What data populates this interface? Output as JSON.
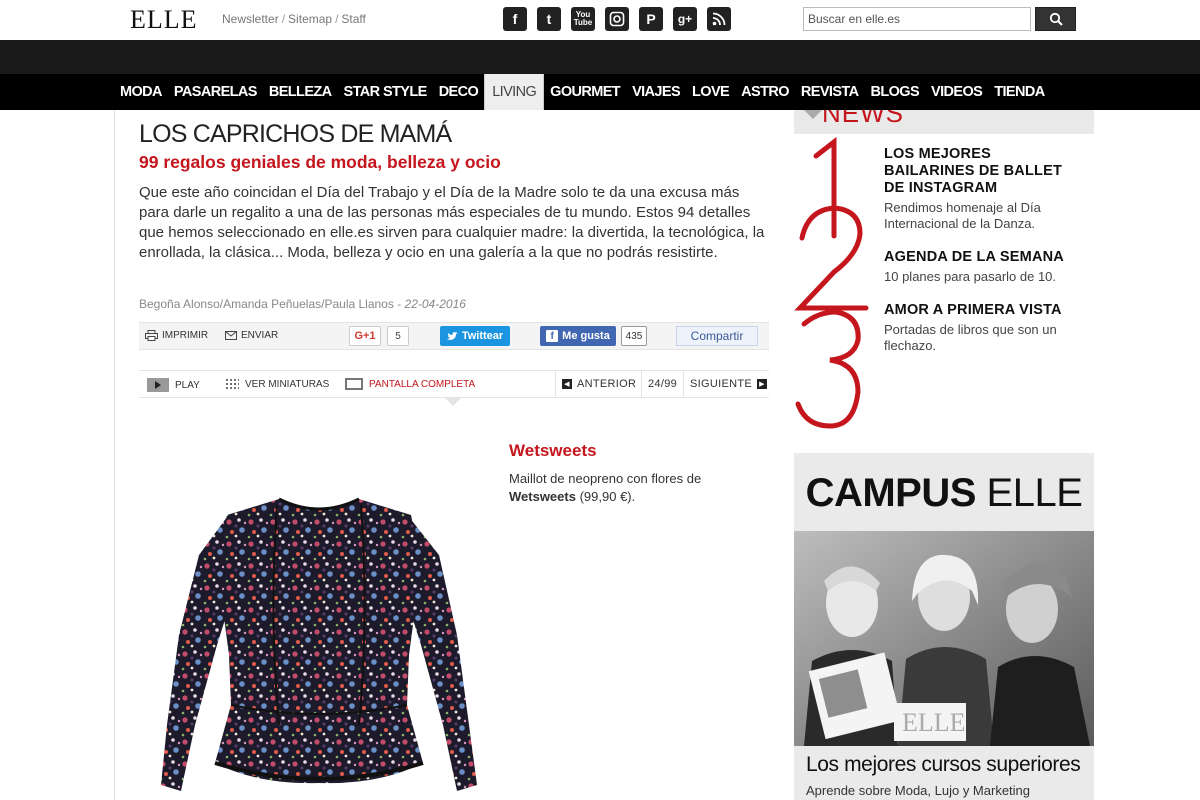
{
  "header": {
    "logo": "ELLE",
    "links": [
      "Newsletter",
      "Sitemap",
      "Staff"
    ],
    "social_icons": [
      "facebook-icon",
      "twitter-icon",
      "youtube-icon",
      "instagram-icon",
      "pinterest-icon",
      "google-plus-icon",
      "rss-icon"
    ],
    "search": {
      "placeholder": "Buscar en elle.es"
    }
  },
  "nav": {
    "items": [
      "MODA",
      "PASARELAS",
      "BELLEZA",
      "STAR STYLE",
      "DECO",
      "LIVING",
      "GOURMET",
      "VIAJES",
      "LOVE",
      "ASTRO",
      "REVISTA",
      "BLOGS",
      "VIDEOS",
      "TIENDA"
    ],
    "active": "LIVING"
  },
  "article": {
    "title": "LOS CAPRICHOS DE MAMÁ",
    "subtitle": "99 regalos geniales de moda, belleza y ocio",
    "intro": "Que este año coincidan el Día del Trabajo y el Día de la Madre solo te da una excusa más para darle un regalito a una de las personas más especiales de tu mundo. Estos 94 detalles que hemos seleccionado en elle.es sirven para cualquier madre: la divertida, la tecnológica, la enrollada, la clásica... Moda, belleza y ocio en una galería a la que no podrás resistirte.",
    "authors": "Begoña Alonso/Amanda Peñuelas/Paula Llanos",
    "date": "22-04-2016"
  },
  "share": {
    "print": "IMPRIMIR",
    "send": "ENVIAR",
    "gplus": "G+1",
    "gplus_count": "5",
    "tweet": "Twittear",
    "fb_like": "Me gusta",
    "fb_count": "435",
    "share": "Compartir"
  },
  "gallery": {
    "play": "PLAY",
    "thumbs": "VER MINIATURAS",
    "fullscreen": "PANTALLA COMPLETA",
    "prev": "ANTERIOR",
    "counter": "24/99",
    "next": "SIGUIENTE"
  },
  "product": {
    "brand": "Wetsweets",
    "desc_prefix": "Maillot de neopreno con flores de",
    "desc_brand": "Wetsweets",
    "price": "(99,90 €)."
  },
  "sidebar": {
    "news_title": "NEWS",
    "items": [
      {
        "title": "LOS MEJORES BAILARINES DE BALLET DE INSTAGRAM",
        "text": "Rendimos homenaje al Día Internacional de la Danza."
      },
      {
        "title": "AGENDA DE LA SEMANA",
        "text": "10 planes para pasarlo de 10."
      },
      {
        "title": "AMOR A PRIMERA VISTA",
        "text": "Portadas de libros que son un flechazo."
      }
    ],
    "campus": {
      "title_bold": "CAMPUS",
      "title_light": "ELLE",
      "caption": "Los mejores cursos superiores",
      "sub": "Aprende sobre Moda, Lujo y Marketing"
    }
  },
  "colors": {
    "brand_red": "#c4161c",
    "nav_bg": "#000000",
    "twitter": "#1b95e0",
    "facebook": "#4267b2"
  }
}
